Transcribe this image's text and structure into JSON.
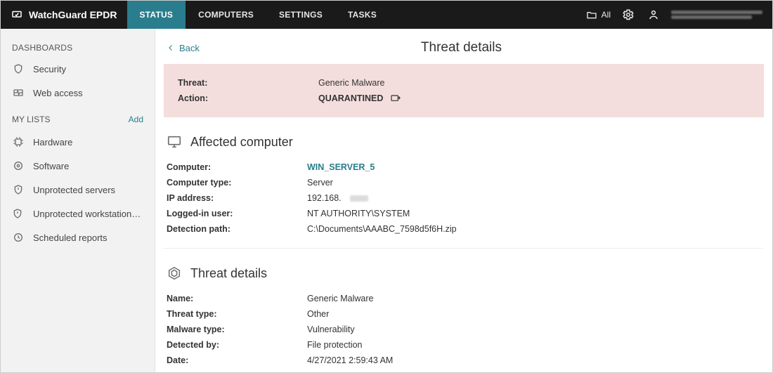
{
  "brand": {
    "name": "WatchGuard EPDR"
  },
  "topnav": {
    "tabs": [
      {
        "label": "STATUS",
        "active": true
      },
      {
        "label": "COMPUTERS",
        "active": false
      },
      {
        "label": "SETTINGS",
        "active": false
      },
      {
        "label": "TASKS",
        "active": false
      }
    ],
    "filter": {
      "label": "All"
    }
  },
  "sidebar": {
    "dashboards_label": "DASHBOARDS",
    "dashboards": [
      {
        "label": "Security",
        "icon": "shield-icon"
      },
      {
        "label": "Web access",
        "icon": "web-access-icon"
      }
    ],
    "mylists_label": "MY LISTS",
    "add_label": "Add",
    "mylists": [
      {
        "label": "Hardware",
        "icon": "hardware-icon"
      },
      {
        "label": "Software",
        "icon": "software-icon"
      },
      {
        "label": "Unprotected servers",
        "icon": "unprotected-icon"
      },
      {
        "label": "Unprotected workstations...",
        "icon": "unprotected-icon"
      },
      {
        "label": "Scheduled reports",
        "icon": "clock-icon"
      }
    ]
  },
  "page": {
    "back_label": "Back",
    "title": "Threat details"
  },
  "alert": {
    "threat_k": "Threat:",
    "threat_v": "Generic Malware",
    "action_k": "Action:",
    "action_v": "QUARANTINED"
  },
  "affected": {
    "title": "Affected computer",
    "rows": {
      "computer_k": "Computer:",
      "computer_v": "WIN_SERVER_5",
      "type_k": "Computer type:",
      "type_v": "Server",
      "ip_k": "IP address:",
      "ip_v": "192.168.",
      "user_k": "Logged-in user:",
      "user_v": "NT AUTHORITY\\SYSTEM",
      "path_k": "Detection path:",
      "path_v": "C:\\Documents\\AAABC_7598d5f6H.zip"
    }
  },
  "details": {
    "title": "Threat details",
    "rows": {
      "name_k": "Name:",
      "name_v": "Generic Malware",
      "threattype_k": "Threat type:",
      "threattype_v": "Other",
      "malwaretype_k": "Malware type:",
      "malwaretype_v": "Vulnerability",
      "detectedby_k": "Detected by:",
      "detectedby_v": "File protection",
      "date_k": "Date:",
      "date_v": "4/27/2021 2:59:43 AM"
    }
  }
}
